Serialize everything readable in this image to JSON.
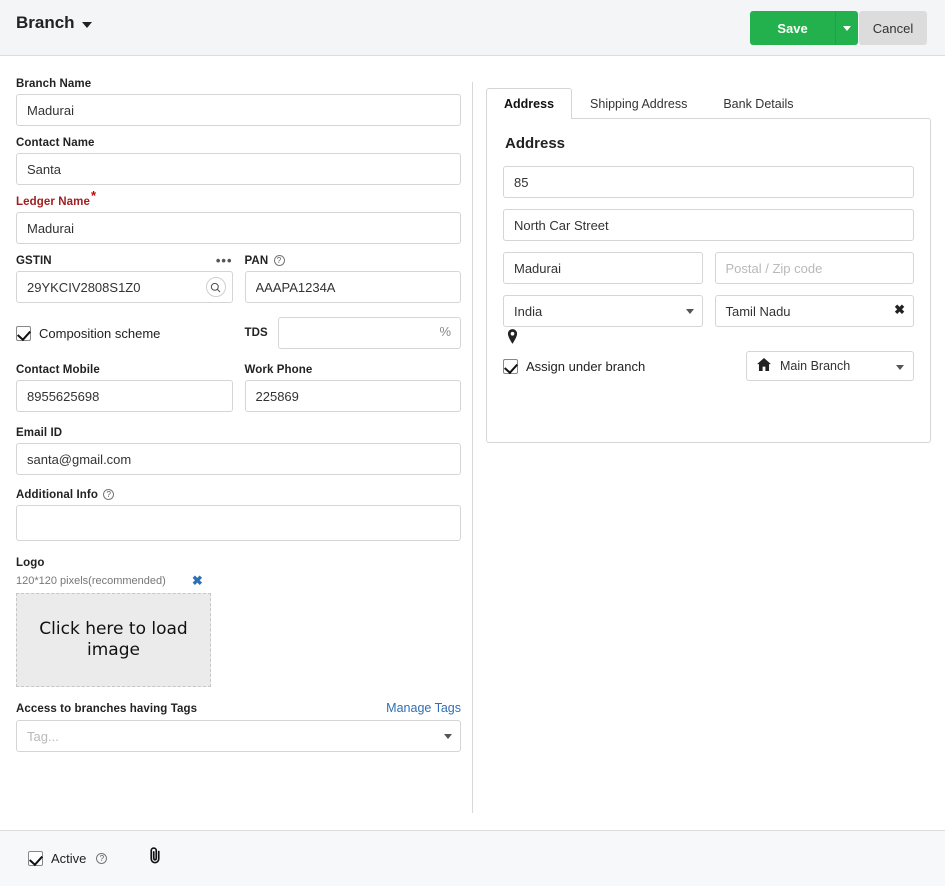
{
  "header": {
    "title": "Branch",
    "title_caret_icon": "chevron-down-icon",
    "save_label": "Save",
    "save_caret_icon": "chevron-down-icon",
    "cancel_label": "Cancel",
    "accent_color": "#22b14c",
    "cancel_color": "#dcdcdc"
  },
  "left": {
    "branch_name": {
      "label": "Branch Name",
      "value": "Madurai"
    },
    "contact_name": {
      "label": "Contact Name",
      "value": "Santa"
    },
    "ledger_name": {
      "label": "Ledger Name",
      "required_mark": "*",
      "value": "Madurai",
      "label_color": "#a02020"
    },
    "gstin": {
      "label": "GSTIN",
      "value": "29YKCIV2808S1Z0",
      "more_icon": "ellipsis-icon",
      "search_icon": "search-icon"
    },
    "pan": {
      "label": "PAN",
      "help_icon": "help-icon",
      "value": "AAAPA1234A"
    },
    "composition_scheme": {
      "label": "Composition scheme",
      "checked": true
    },
    "tds": {
      "label": "TDS",
      "value": "",
      "suffix": "%"
    },
    "contact_mobile": {
      "label": "Contact Mobile",
      "value": "8955625698"
    },
    "work_phone": {
      "label": "Work Phone",
      "value": "225869"
    },
    "email_id": {
      "label": "Email ID",
      "value": "santa@gmail.com"
    },
    "additional_info": {
      "label": "Additional Info",
      "help_icon": "help-icon",
      "value": ""
    },
    "logo": {
      "label": "Logo",
      "hint": "120*120 pixels(recommended)",
      "remove_icon": "close-x-icon",
      "remove_color": "#2f6fb5",
      "placeholder_text": "Click here to load image"
    },
    "tags": {
      "label": "Access to branches having Tags",
      "manage_link": "Manage Tags",
      "link_color": "#2f6fb5",
      "placeholder": "Tag...",
      "value": ""
    }
  },
  "right": {
    "tabs": [
      {
        "label": "Address",
        "active": true
      },
      {
        "label": "Shipping Address",
        "active": false
      },
      {
        "label": "Bank Details",
        "active": false
      }
    ],
    "panel_title": "Address",
    "address_line1": {
      "value": "85",
      "placeholder": ""
    },
    "address_line2": {
      "value": "North Car Street",
      "placeholder": ""
    },
    "city": {
      "value": "Madurai",
      "placeholder": ""
    },
    "postal": {
      "value": "",
      "placeholder": "Postal / Zip code"
    },
    "country": {
      "value": "India",
      "caret_icon": "chevron-down-icon"
    },
    "state": {
      "value": "Tamil Nadu",
      "clear_icon": "close-x-icon"
    },
    "map_pin_icon": "map-pin-icon",
    "assign_under_branch": {
      "label": "Assign under branch",
      "checked": true
    },
    "branch_select": {
      "value": "Main Branch",
      "home_icon": "home-icon",
      "caret_icon": "chevron-down-icon"
    }
  },
  "footer": {
    "active": {
      "label": "Active",
      "checked": true,
      "help_icon": "help-icon"
    },
    "attachment_icon": "paperclip-icon"
  }
}
